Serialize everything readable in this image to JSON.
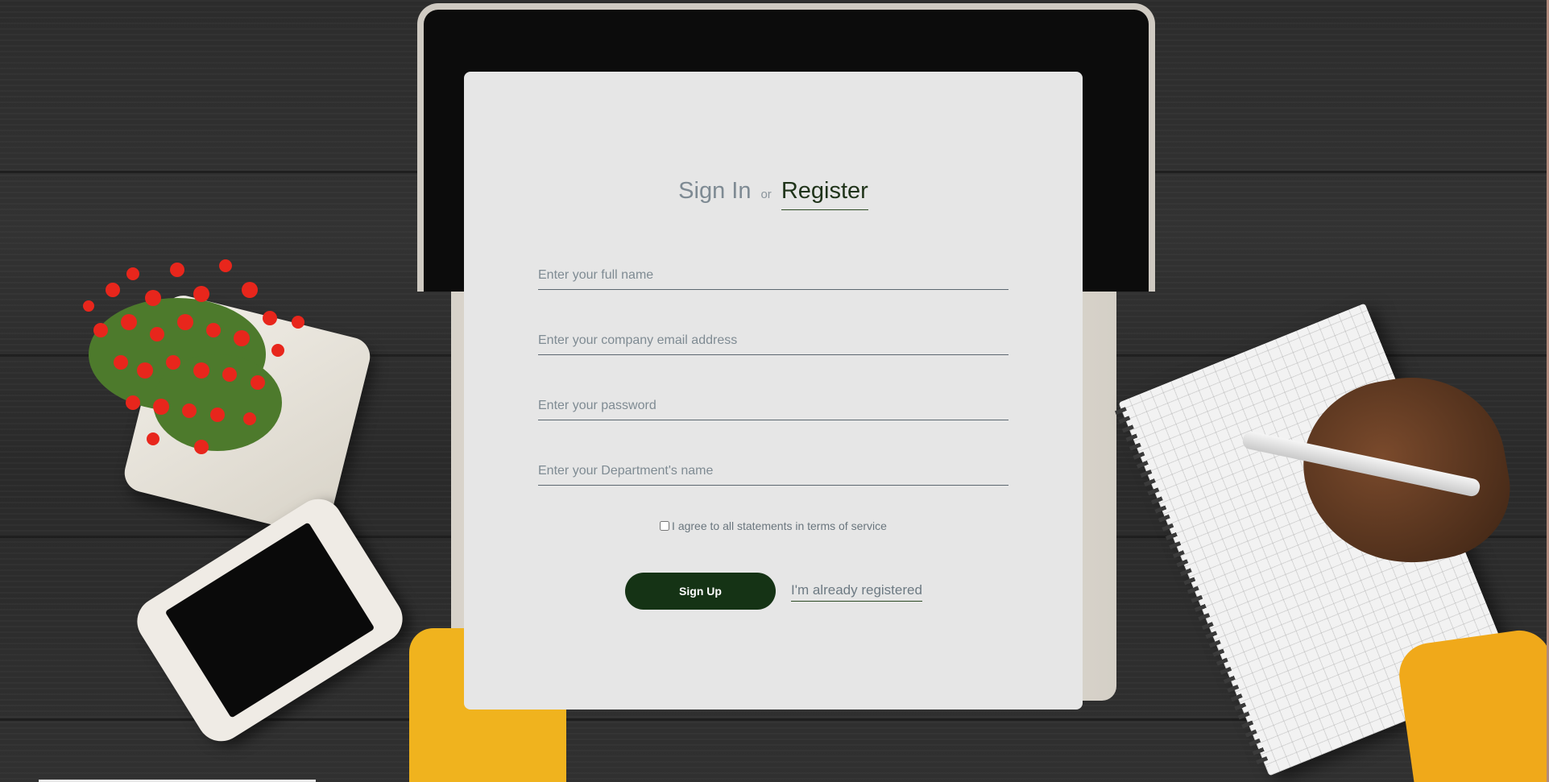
{
  "auth": {
    "tab_signin": "Sign In",
    "tab_separator": "or",
    "tab_register": "Register"
  },
  "form": {
    "full_name_placeholder": "Enter your full name",
    "email_placeholder": "Enter your company email address",
    "password_placeholder": "Enter your password",
    "department_placeholder": "Enter your Department's name",
    "terms_label": "I agree to all statements in terms of service",
    "terms_checked": false,
    "signup_label": "Sign Up",
    "already_registered_label": "I'm already registered"
  },
  "colors": {
    "card_background": "#e6e6e6",
    "primary_button": "#153315",
    "active_tab": "#1f3319",
    "inactive_text": "#7e8a93",
    "sleeve_yellow": "#f0b31e",
    "flower_red": "#e8261c"
  }
}
